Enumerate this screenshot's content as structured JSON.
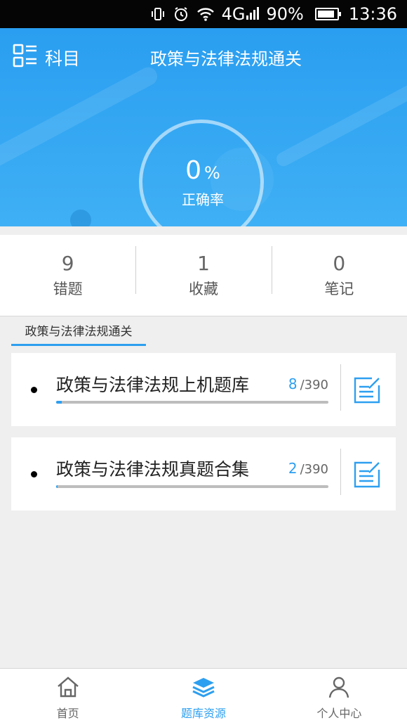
{
  "status_bar": {
    "network": "4G",
    "battery": "90%",
    "time": "13:36",
    "icons": [
      "vibrate-icon",
      "alarm-icon",
      "wifi-icon",
      "signal-icon",
      "battery-icon"
    ]
  },
  "header": {
    "menu_label": "科目",
    "title": "政策与法律法规通关",
    "accuracy_value": "0",
    "accuracy_unit": "%",
    "accuracy_label": "正确率"
  },
  "stats": [
    {
      "value": "9",
      "label": "错题"
    },
    {
      "value": "1",
      "label": "收藏"
    },
    {
      "value": "0",
      "label": "笔记"
    }
  ],
  "section_tab": "政策与法律法规通关",
  "question_banks": [
    {
      "title": "政策与法律法规上机题库",
      "done": "8",
      "total": "/390",
      "progress": 0.02
    },
    {
      "title": "政策与法律法规真题合集",
      "done": "2",
      "total": "/390",
      "progress": 0.005
    }
  ],
  "bottom_nav": [
    {
      "label": "首页",
      "icon": "home-icon",
      "active": false
    },
    {
      "label": "题库资源",
      "icon": "layers-icon",
      "active": true
    },
    {
      "label": "个人中心",
      "icon": "user-icon",
      "active": false
    }
  ],
  "colors": {
    "accent": "#2d9ff0",
    "header_bg": "#3aaaf3",
    "page_bg": "#efefef"
  }
}
